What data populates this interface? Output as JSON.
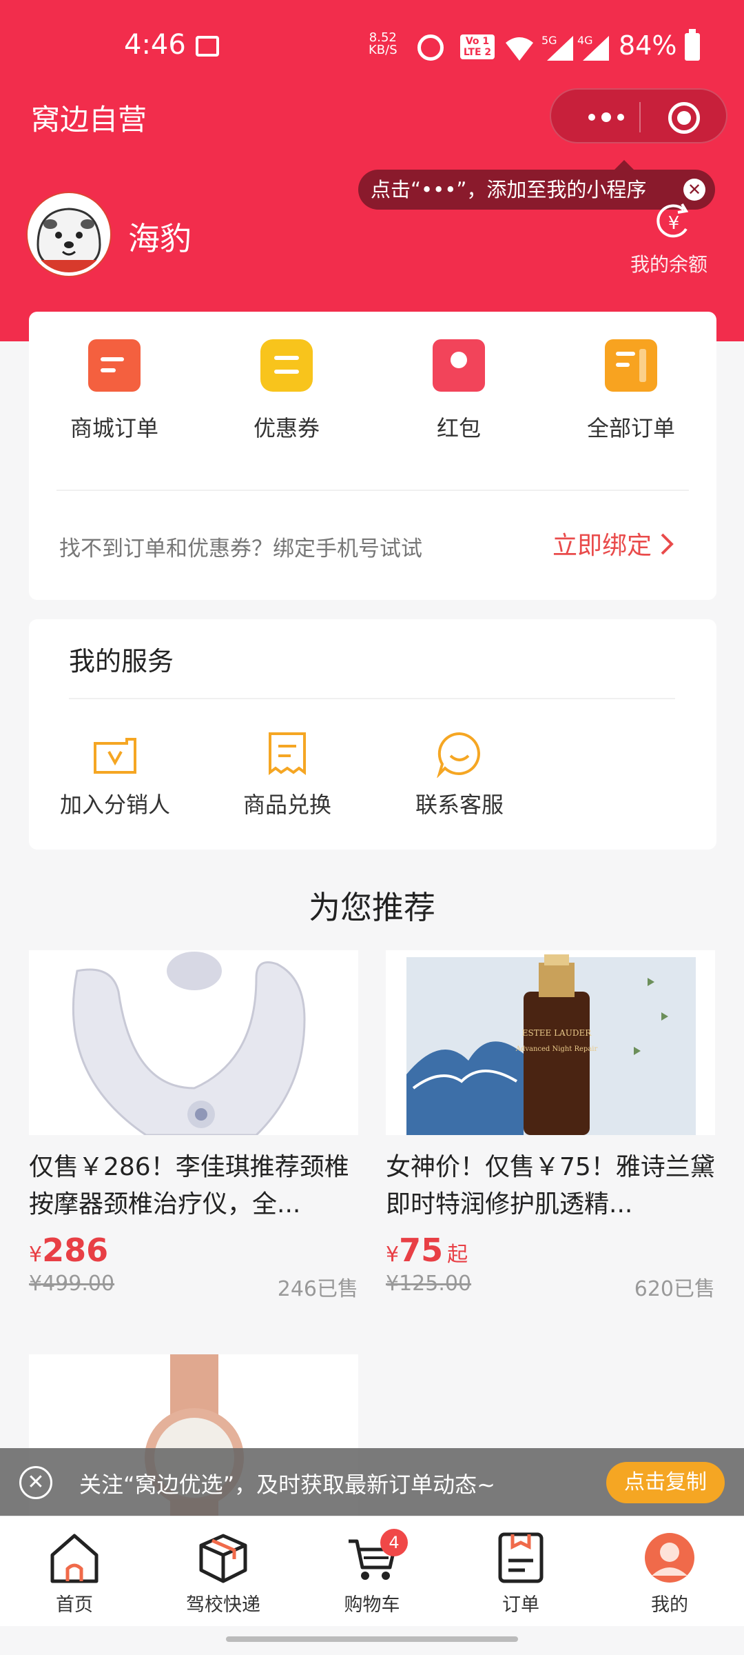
{
  "status_bar": {
    "time": "4:46",
    "net_speed_value": "8.52",
    "net_speed_unit": "KB/S",
    "volte_top": "Vo 1",
    "volte_bottom": "LTE 2",
    "sig1_label": "5G",
    "sig2_label": "4G",
    "battery": "84%"
  },
  "header": {
    "app_title": "窝边自营",
    "tip_text": "点击“•••”，添加至我的小程序",
    "tip_close": "✕",
    "nickname": "海豹",
    "balance_label": "我的余额",
    "balance_icon_glyph": "¥"
  },
  "orders": {
    "items": [
      {
        "label": "商城订单",
        "color": "#f4603f",
        "icon": "orders-icon"
      },
      {
        "label": "优惠券",
        "color": "#f8c41c",
        "icon": "coupon-icon"
      },
      {
        "label": "红包",
        "color": "#f2445a",
        "icon": "red-packet-icon"
      },
      {
        "label": "全部订单",
        "color": "#f8a320",
        "icon": "all-orders-icon"
      }
    ],
    "bind_tip": "找不到订单和优惠券？绑定手机号试试",
    "bind_button": "立即绑定"
  },
  "services": {
    "title": "我的服务",
    "items": [
      {
        "label": "加入分销人",
        "icon": "distributor-icon"
      },
      {
        "label": "商品兑换",
        "icon": "exchange-icon"
      },
      {
        "label": "联系客服",
        "icon": "customer-service-icon"
      }
    ],
    "icon_color": "#f5a623"
  },
  "recommend": {
    "title": "为您推荐",
    "products": [
      {
        "name": "仅售￥286！李佳琪推荐颈椎按摩器颈椎治疗仪，全...",
        "currency": "¥",
        "price": "286",
        "suffix": "",
        "original_price": "¥499.00",
        "sold": "246已售"
      },
      {
        "name": "女神价！仅售￥75！雅诗兰黛即时特润修护肌透精...",
        "currency": "¥",
        "price": "75",
        "suffix": "起",
        "original_price": "¥125.00",
        "sold": "620已售"
      }
    ],
    "bottle_label_brand": "ESTEE LAUDER",
    "bottle_label_product": "Advanced Night Repair"
  },
  "follow_banner": {
    "text": "关注“窝边优选”，及时获取最新订单动态~",
    "button": "点击复制",
    "close": "✕"
  },
  "tabbar": {
    "items": [
      {
        "label": "首页",
        "icon": "home-icon"
      },
      {
        "label": "驾校快递",
        "icon": "package-icon"
      },
      {
        "label": "购物车",
        "icon": "cart-icon"
      },
      {
        "label": "订单",
        "icon": "order-list-icon"
      },
      {
        "label": "我的",
        "icon": "profile-icon"
      }
    ],
    "cart_badge": "4",
    "active_color": "#f06a4a"
  },
  "colors": {
    "brand_red": "#f22d4c",
    "price_red": "#e83f45",
    "accent_orange": "#f5a623"
  }
}
